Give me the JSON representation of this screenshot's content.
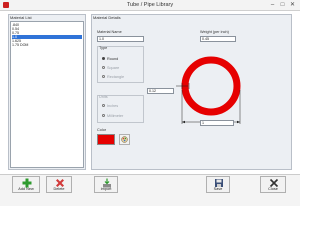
{
  "window": {
    "title": "Tube / Pipe Library",
    "min_glyph": "–",
    "max_glyph": "□",
    "close_glyph": "✕"
  },
  "material_list": {
    "legend": "Material List",
    "items": [
      {
        "label": ".840",
        "selected": false
      },
      {
        "label": "0.54",
        "selected": false
      },
      {
        "label": "0.75",
        "selected": false
      },
      {
        "label": "1.0",
        "selected": true
      },
      {
        "label": "1.625",
        "selected": false
      },
      {
        "label": "1.75 DOM",
        "selected": false
      }
    ]
  },
  "material_details": {
    "legend": "Material Details",
    "name_label": "Material Name",
    "name_value": "1.0",
    "weight_label": "Weight (per inch)",
    "weight_value": "0.45",
    "type": {
      "legend": "Type",
      "options": [
        "Round",
        "Square",
        "Rectangle"
      ],
      "selected": "Round"
    },
    "units": {
      "legend": "Units",
      "options": [
        "Inches",
        "Millimeter"
      ]
    },
    "wall_thickness_value": "0.12",
    "diameter_value": "1",
    "color_label": "Color",
    "color_value": "#e60000",
    "color_picker_icon": "palette-icon"
  },
  "toolbar": {
    "add_new": "Add New",
    "delete": "Delete",
    "import": "Import",
    "save": "Save",
    "close": "Close"
  },
  "colors": {
    "accent": "#2f73d8",
    "ring": "#e60000",
    "add_icon": "#2e9a2e",
    "delete_icon": "#d23a3a"
  }
}
